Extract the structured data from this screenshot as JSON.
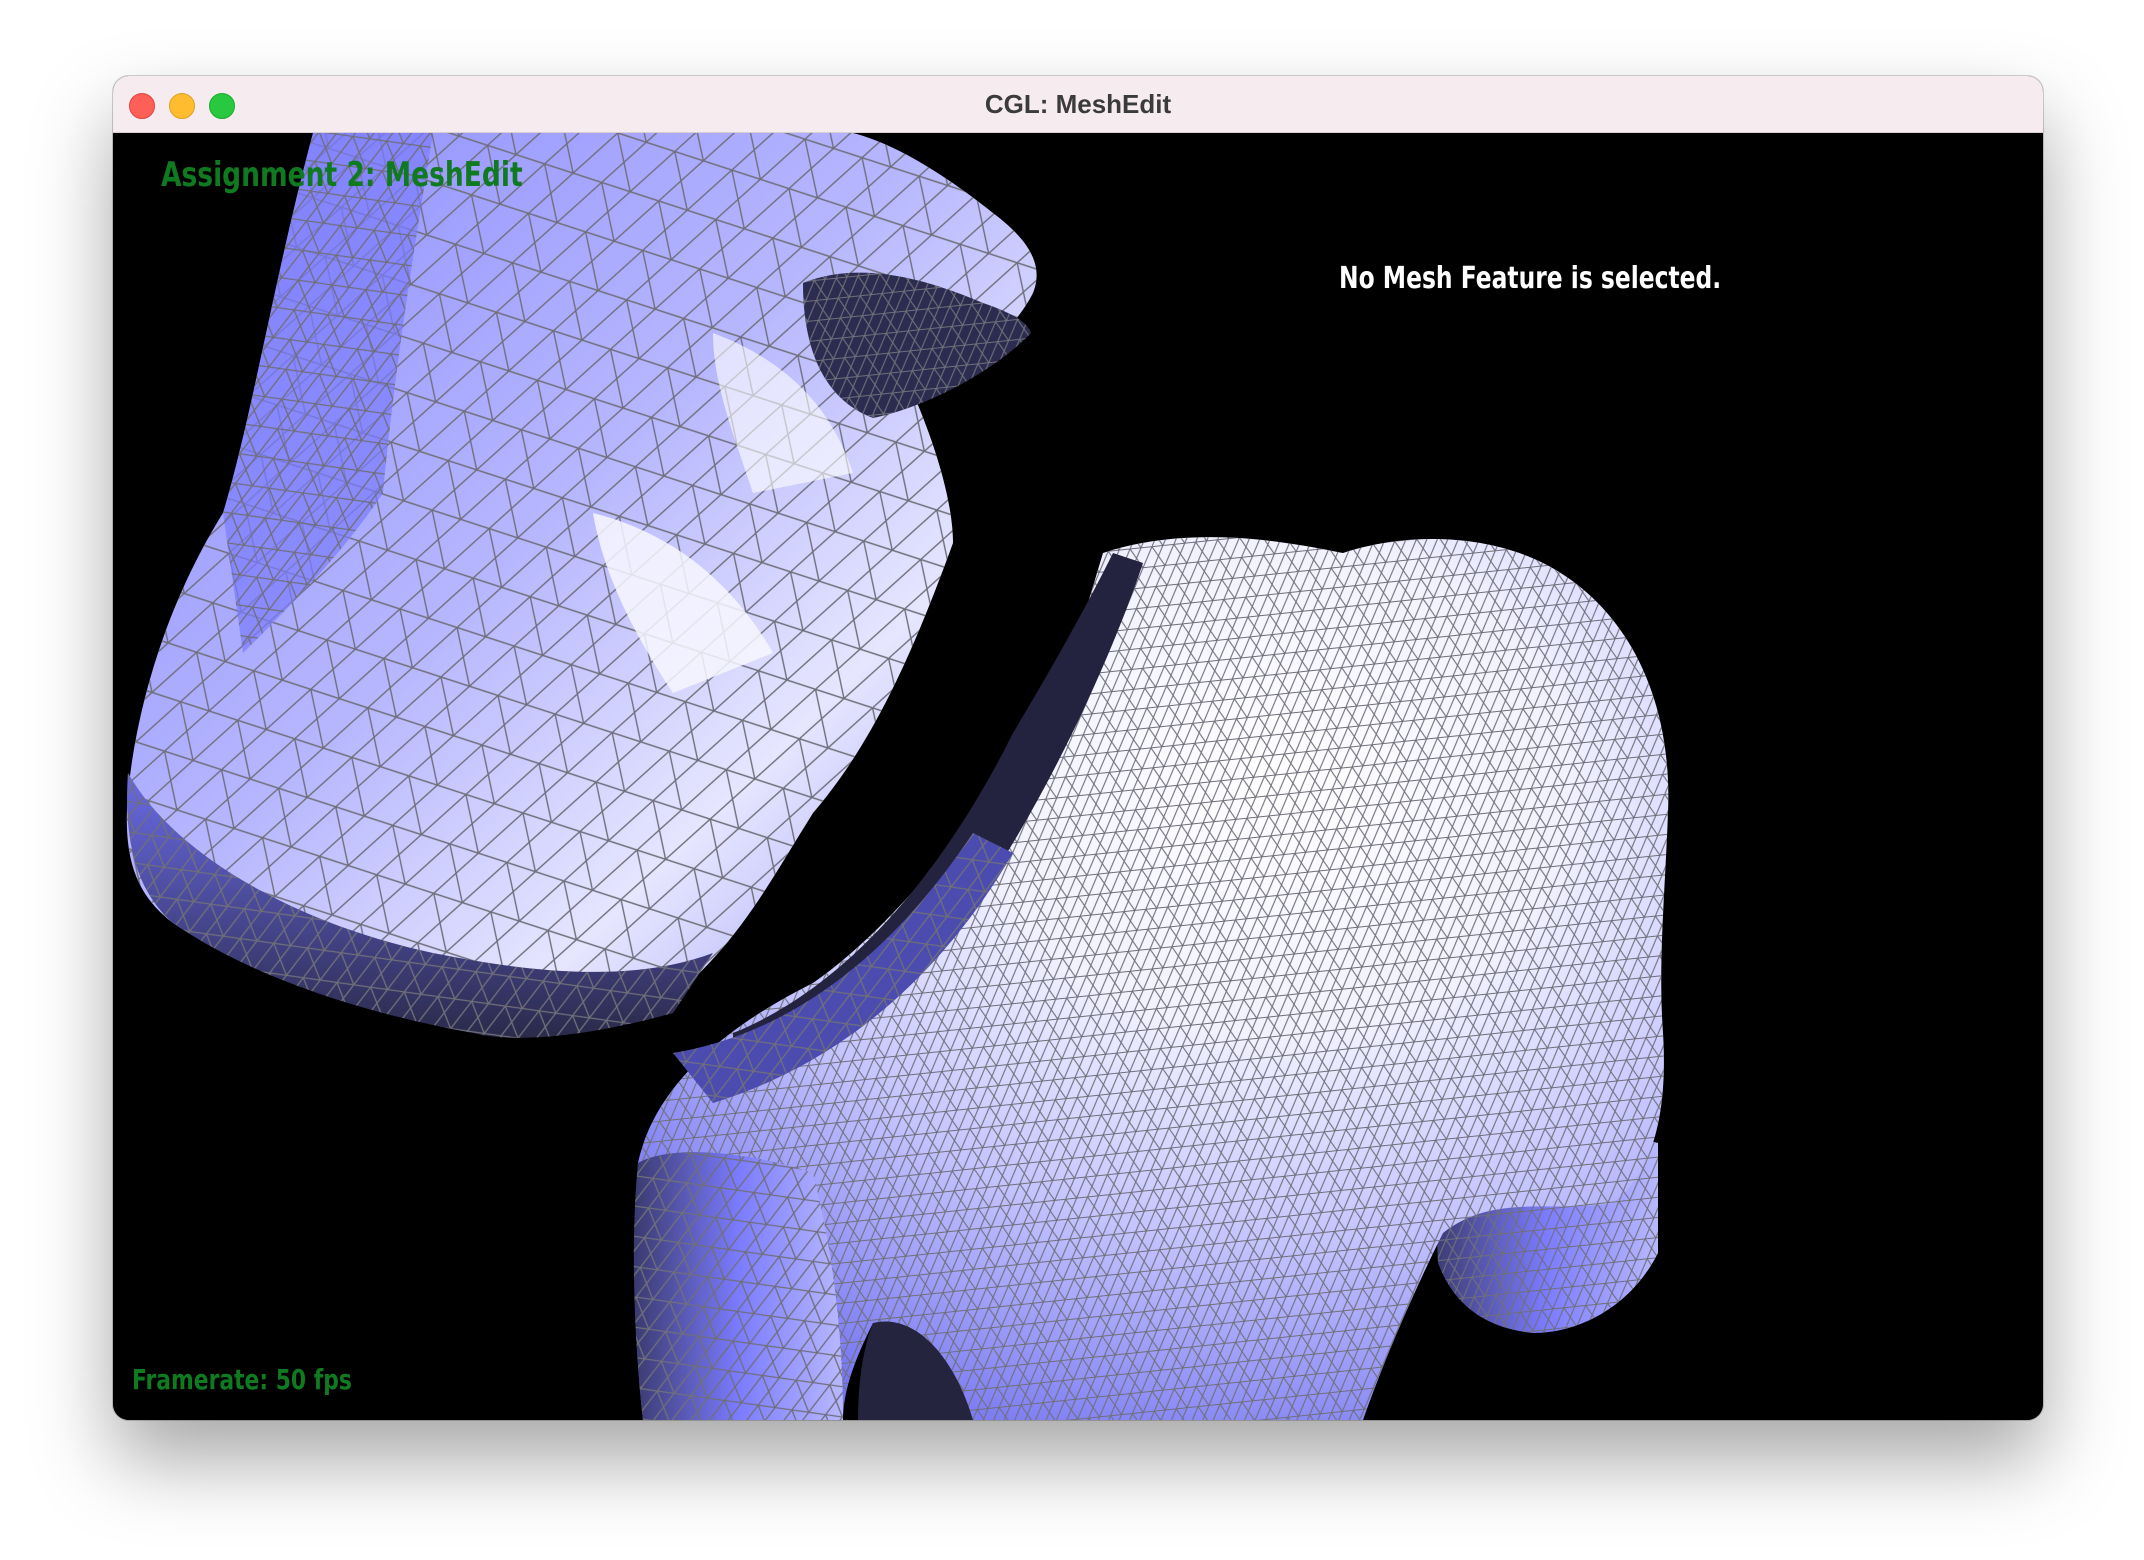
{
  "window": {
    "title": "CGL: MeshEdit",
    "controls": [
      "close",
      "minimize",
      "maximize"
    ]
  },
  "viewport": {
    "background_color": "#000000",
    "mesh_color": "#7b7bff",
    "wireframe_color": "#6f6f7a",
    "hud": {
      "title": "Assignment 2: MeshEdit",
      "selection_status": "No Mesh Feature is selected.",
      "framerate": "Framerate: 50 fps",
      "title_color": "#0f7a1f",
      "status_color": "#ffffff"
    }
  }
}
